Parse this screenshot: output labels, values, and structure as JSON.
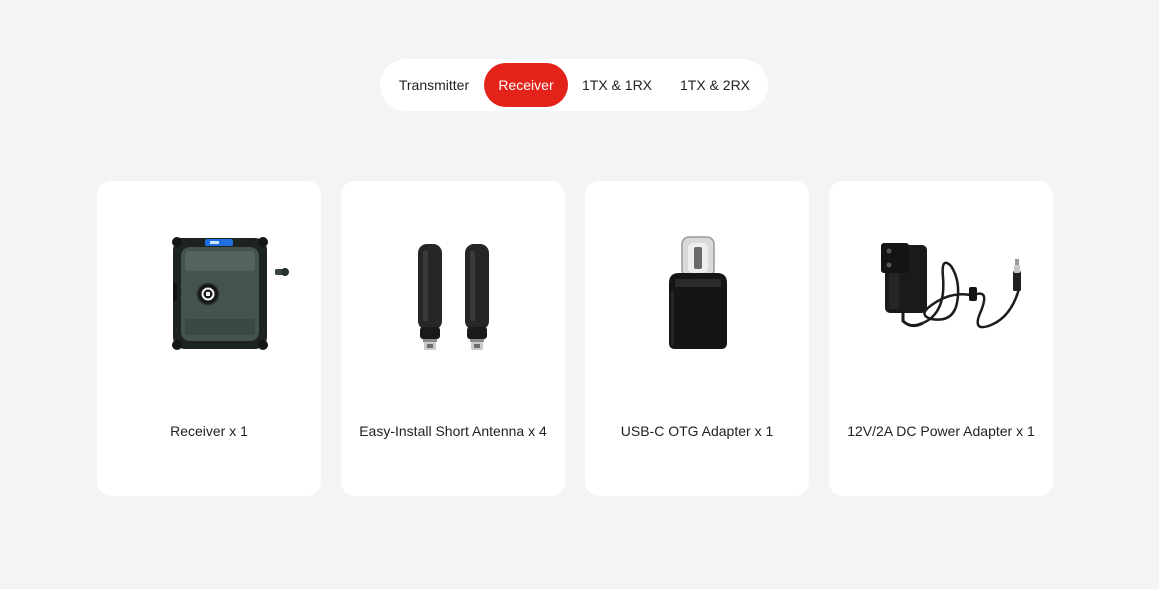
{
  "tabs": [
    {
      "label": "Transmitter",
      "active": false
    },
    {
      "label": "Receiver",
      "active": true
    },
    {
      "label": "1TX & 1RX",
      "active": false
    },
    {
      "label": "1TX & 2RX",
      "active": false
    }
  ],
  "items": [
    {
      "label": "Receiver x 1",
      "icon": "receiver-device-icon"
    },
    {
      "label": "Easy-Install Short Antenna x 4",
      "icon": "antenna-icon"
    },
    {
      "label": "USB-C OTG Adapter x 1",
      "icon": "usb-c-adapter-icon"
    },
    {
      "label": "12V/2A DC Power Adapter x 1",
      "icon": "power-adapter-icon"
    }
  ],
  "colors": {
    "background": "#f4f4f6",
    "accent": "#e32219",
    "card": "#ffffff"
  }
}
